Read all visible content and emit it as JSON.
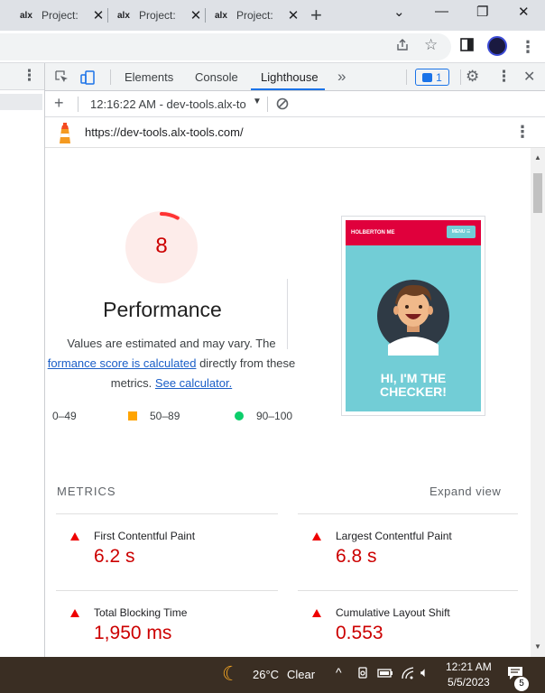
{
  "browser": {
    "tabs": [
      {
        "favicon": "alx",
        "title": "Project: "
      },
      {
        "favicon": "alx",
        "title": "Project: "
      },
      {
        "favicon": "alx",
        "title": "Project: "
      }
    ],
    "tab_close_glyph": "✕",
    "new_tab_glyph": "+",
    "window_controls": {
      "collapse": "⌄",
      "minimize": "—",
      "restore": "❐",
      "close": "✕"
    },
    "toolbar_icons": [
      "share-icon",
      "star-icon",
      "side-panel-icon",
      "profile-avatar",
      "menu-icon"
    ]
  },
  "devtools": {
    "tabs": [
      {
        "label": "Elements"
      },
      {
        "label": "Console"
      },
      {
        "label": "Lighthouse"
      }
    ],
    "active_tab": "Lighthouse",
    "more_tabs_glyph": "»",
    "issues_count": "1",
    "accent": "#1a73e8"
  },
  "lighthouse": {
    "report_selector": "12:16:22 AM - dev-tools.alx-to",
    "url": "https://dev-tools.alx-tools.com/",
    "category": {
      "score": "8",
      "score_fraction": 0.08,
      "title": "Performance",
      "desc_line1": "Values are estimated and may vary. The",
      "desc_link1": "formance score is calculated",
      "desc_line2_rest": " directly from these",
      "desc_line3_start": "metrics. ",
      "desc_link2": "See calculator."
    },
    "legend": [
      {
        "range": "0–49",
        "shape": "triangle",
        "color": "#ff3333"
      },
      {
        "range": "50–89",
        "shape": "square",
        "color": "#ffa400"
      },
      {
        "range": "90–100",
        "shape": "circle",
        "color": "#0cce6b"
      }
    ],
    "screenshot": {
      "brand": "HOLBERTON ME",
      "menu": "MENU ☰",
      "hero_line1": "HI, I'M THE",
      "hero_line2": "CHECKER!"
    },
    "metrics_header": "METRICS",
    "expand_label": "Expand view",
    "metrics": [
      {
        "name": "First Contentful Paint",
        "value": "6.2 s"
      },
      {
        "name": "Largest Contentful Paint",
        "value": "6.8 s"
      },
      {
        "name": "Total Blocking Time",
        "value": "1,950 ms"
      },
      {
        "name": "Cumulative Layout Shift",
        "value": "0.553"
      }
    ],
    "fail_color": "#cc0000"
  },
  "taskbar": {
    "weather_temp": "26°C",
    "weather_text": "Clear",
    "time": "12:21 AM",
    "date": "5/5/2023",
    "notification_count": "5"
  }
}
